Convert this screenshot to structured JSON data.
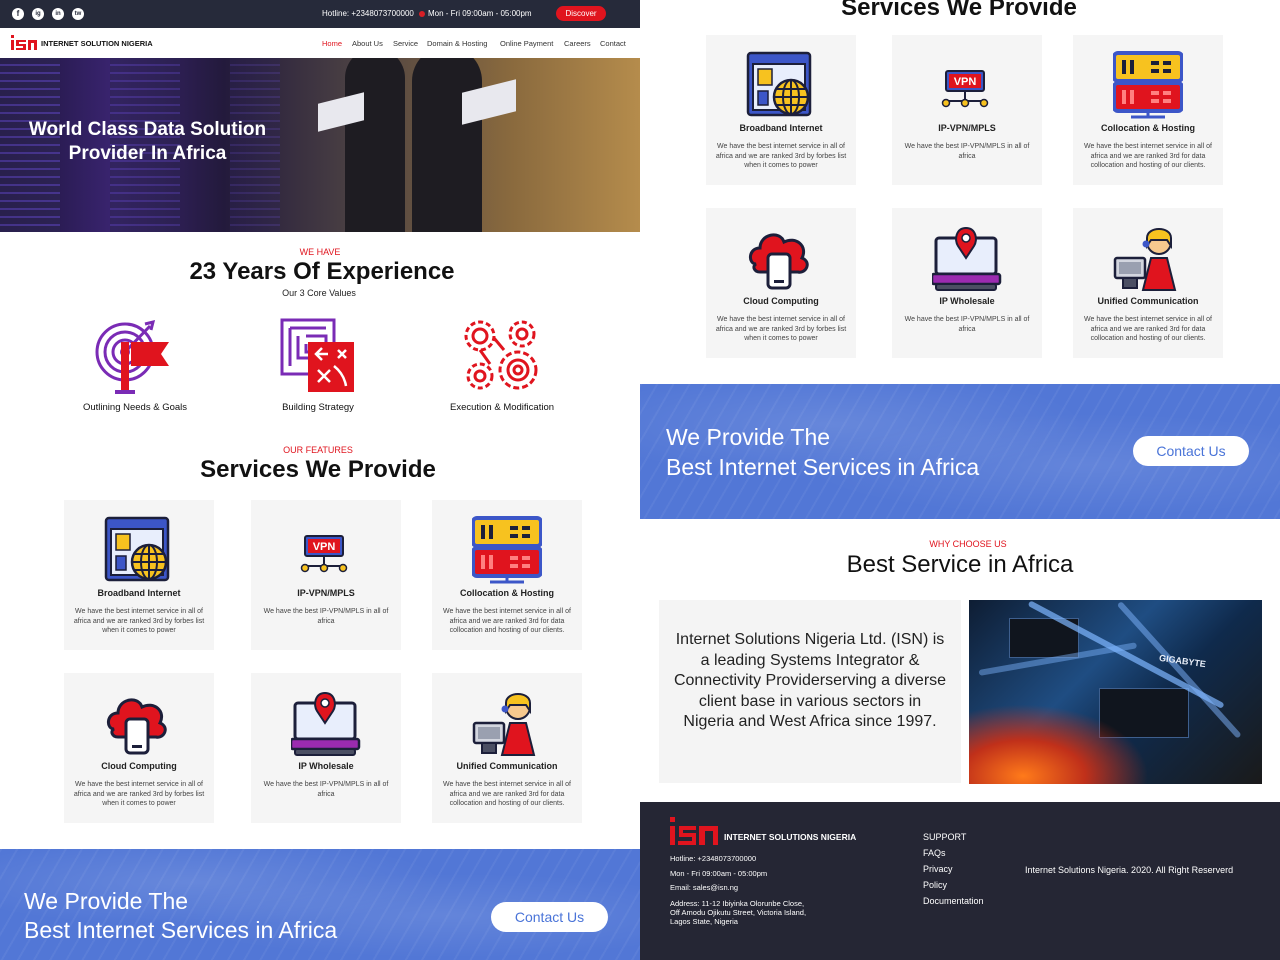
{
  "topbar": {
    "social": [
      "f",
      "ig",
      "in",
      "tw"
    ],
    "hotline": "Hotline: +2348073700000",
    "hours": "Mon - Fri 09:00am - 05:00pm",
    "discover": "Discover"
  },
  "nav": {
    "brand": "INTERNET SOLUTION NIGERIA",
    "links": [
      "Home",
      "About Us",
      "Service",
      "Domain & Hosting",
      "Online Payment",
      "Careers",
      "Contact"
    ]
  },
  "hero": {
    "line1": "World Class Data Solution",
    "line2": "Provider In Africa"
  },
  "experience": {
    "kicker": "WE HAVE",
    "title": "23 Years Of Experience",
    "subtitle": "Our 3 Core Values",
    "values": [
      "Outlining Needs & Goals",
      "Building Strategy",
      "Execution & Modification"
    ]
  },
  "services": {
    "kicker": "OUR FEATURES",
    "title": "Services We Provide",
    "cards": [
      {
        "title": "Broadband Internet",
        "desc": "We have the best internet service in all of africa and we are ranked 3rd by forbes list when it comes to power",
        "icon": "broadband-icon"
      },
      {
        "title": "IP-VPN/MPLS",
        "desc": "We have the best IP-VPN/MPLS in all of africa",
        "icon": "vpn-icon"
      },
      {
        "title": "Collocation & Hosting",
        "desc": "We have the best internet service in all of africa and we are ranked 3rd for data collocation and hosting of our clients.",
        "icon": "server-icon"
      },
      {
        "title": "Cloud Computing",
        "desc": "We have the best internet service in all of africa and we are ranked 3rd by forbes list when it comes to power",
        "icon": "cloud-icon"
      },
      {
        "title": "IP Wholesale",
        "desc": "We have the best IP-VPN/MPLS in all of africa",
        "icon": "location-laptop-icon"
      },
      {
        "title": "Unified Communication",
        "desc": "We have the best internet service in all of africa and we are ranked 3rd for data collocation and hosting of our clients.",
        "icon": "support-agent-icon"
      }
    ]
  },
  "banner": {
    "line1": "We Provide The",
    "line2": "Best Internet Services in Africa",
    "cta": "Contact Us"
  },
  "why": {
    "kicker": "WHY CHOOSE US",
    "title": "Best Service in Africa",
    "body": "Internet Solutions Nigeria Ltd. (ISN) is a leading Systems Integrator & Connectivity Providerserving a diverse client base in various sectors in Nigeria and West Africa since 1997.",
    "image_text": "GIGABYTE"
  },
  "footer": {
    "brand": "INTERNET SOLUTIONS NIGERIA",
    "hotline": "Hotline: +2348073700000",
    "hours": "Mon - Fri 09:00am - 05:00pm",
    "email": "Email: sales@isn.ng",
    "address1": "Address: 11-12 Ibiyinka Olorunbe Close,",
    "address2": "Off Amodu Ojikutu Street, Victoria Island,",
    "address3": "Lagos State, Nigeria",
    "links": [
      "SUPPORT",
      "FAQs",
      "Privacy",
      "Policy",
      "Documentation"
    ],
    "copyright": "Internet Solutions Nigeria. 2020. All Right Reserverd"
  },
  "colors": {
    "brand_red": "#e0141e",
    "navy": "#262a3a",
    "banner_blue": "#5277d6",
    "icon_blue": "#3c56c8",
    "icon_yellow": "#f7c21f"
  }
}
